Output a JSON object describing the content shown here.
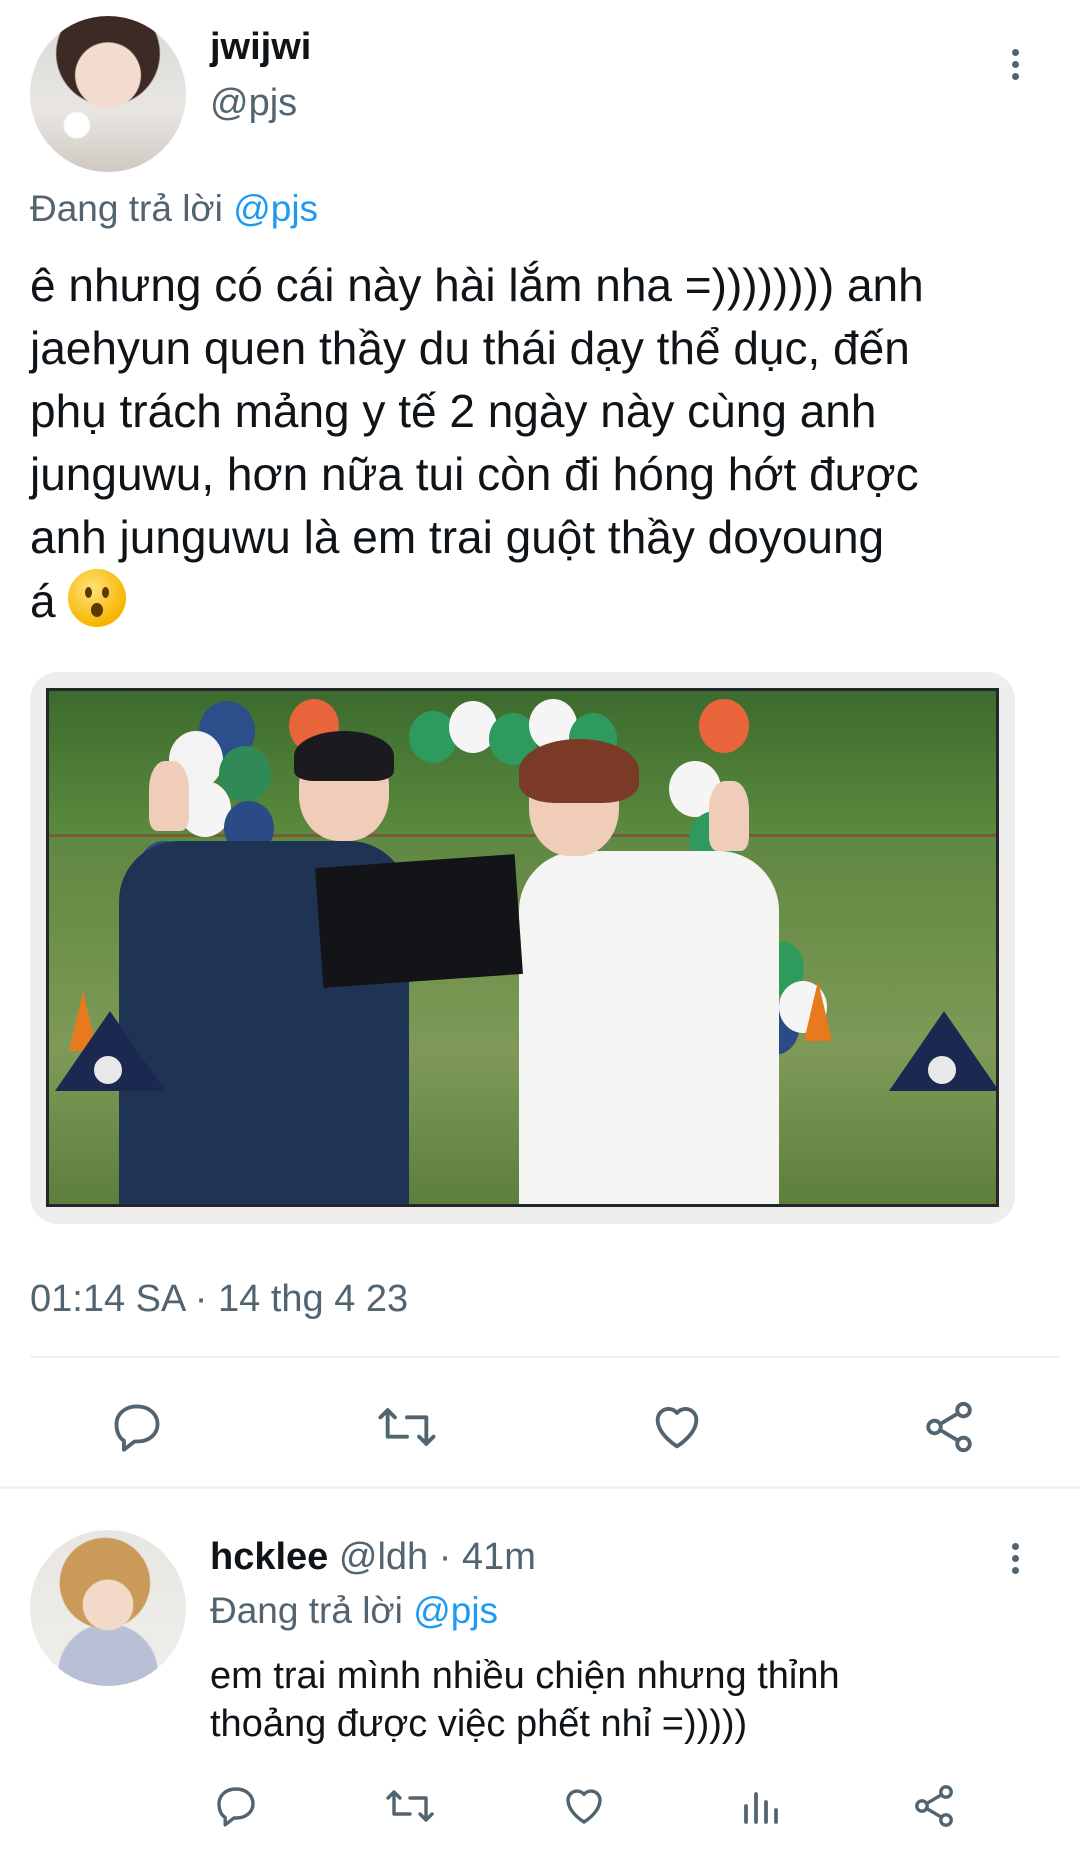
{
  "tweet": {
    "display_name": "jwijwi",
    "handle": "@pjs",
    "reply_prefix": "Đang trả lời",
    "reply_to": "@pjs",
    "text": "ê nhưng có cái này hài lắm nha =)))))))) anh\njaehyun quen thầy du thái dạy thể dục, đến\nphụ trách mảng y tế 2 ngày này cùng anh\njunguwu, hơn nữa tui còn đi hóng hớt được\nanh junguwu là em trai guột thầy doyoung\ná",
    "timestamp": "01:14 SA · 14 thg 4 23",
    "icons": [
      "reply-icon",
      "retweet-icon",
      "like-icon",
      "share-icon"
    ]
  },
  "reply": {
    "display_name": "hcklee",
    "handle": "@ldh",
    "time": "· 41m",
    "reply_prefix": "Đang trả lời",
    "reply_to": "@pjs",
    "text": "em trai mình nhiều chiện nhưng thỉnh\nthoảng được việc phết nhỉ =)))))",
    "icons": [
      "reply-icon",
      "retweet-icon",
      "like-icon",
      "analytics-icon",
      "share-icon"
    ]
  },
  "colors": {
    "text": "#0f1419",
    "muted": "#536471",
    "link": "#1d9bf0",
    "divider": "#eff3f4"
  }
}
